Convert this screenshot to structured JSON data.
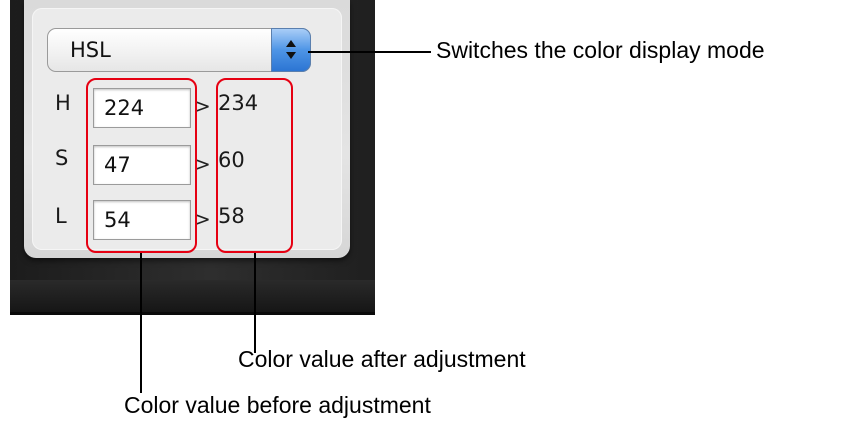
{
  "color_panel": {
    "mode_select": {
      "value": "HSL"
    },
    "rows": [
      {
        "label": "H",
        "before": "224",
        "separator": ">",
        "after": "234"
      },
      {
        "label": "S",
        "before": "47",
        "separator": ">",
        "after": "60"
      },
      {
        "label": "L",
        "before": "54",
        "separator": ">",
        "after": "58"
      }
    ]
  },
  "annotations": {
    "mode": "Switches the color display mode",
    "after": "Color value after adjustment",
    "before": "Color value before adjustment"
  },
  "colors": {
    "highlight": "#e60012",
    "select_arrow_accent": "#3b82dc"
  },
  "icons": {
    "mode_arrows": "up-down-chevron-icon"
  }
}
